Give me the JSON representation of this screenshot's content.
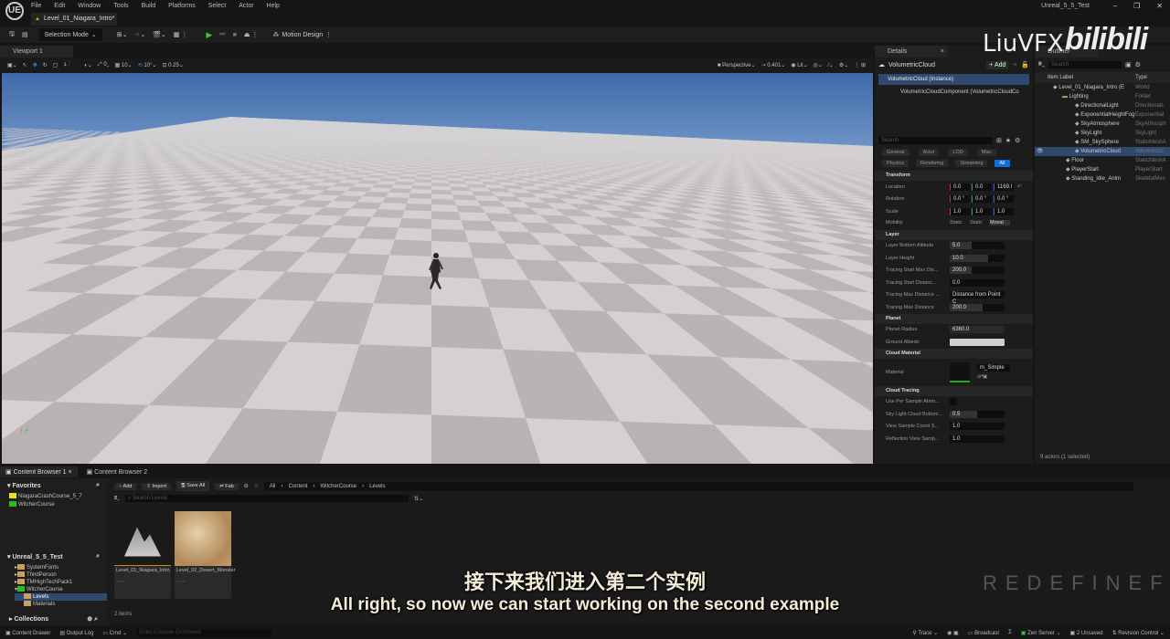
{
  "app": {
    "logo": "UE",
    "project": "Unreal_5_5_Test",
    "menu": [
      "File",
      "Edit",
      "Window",
      "Tools",
      "Build",
      "Platforms",
      "Select",
      "Actor",
      "Help"
    ],
    "doc_tab": "Level_01_Niagara_Intro*"
  },
  "toolbar": {
    "selection_mode": "Selection Mode",
    "motion_design": "Motion Design"
  },
  "viewport": {
    "tab": "Viewport 1",
    "snap_translate": "0",
    "snap_grid": "10",
    "snap_rotate": "10°",
    "snap_scale": "0.25",
    "view_mode": "Perspective",
    "camera_speed": "0.401",
    "lit": "Lit"
  },
  "details": {
    "tab": "Details",
    "actor": "VolumetricCloud",
    "add": "+ Add",
    "instance": "VolumetricCloud (Instance)",
    "component": "VolumetricCloudComponent (VolumetricCloudCo",
    "search_placeholder": "Search",
    "filters1": [
      "General",
      "Actor",
      "LOD",
      "Misc"
    ],
    "filters2": [
      "Physics",
      "Rendering",
      "Streaming",
      "All"
    ],
    "transform": {
      "title": "Transform",
      "location": {
        "label": "Location",
        "x": "0.0",
        "y": "0.0",
        "z": "1169.l"
      },
      "rotation": {
        "label": "Rotation",
        "x": "0.0 °",
        "y": "0.0 °",
        "z": "0.0 °"
      },
      "scale": {
        "label": "Scale",
        "x": "1.0",
        "y": "1.0",
        "z": "1.0"
      },
      "mobility": {
        "label": "Mobility",
        "options": [
          "Static",
          "Static",
          "Moval"
        ]
      }
    },
    "layer": {
      "title": "Layer",
      "rows": [
        {
          "label": "Layer Bottom Altitude",
          "value": "5.0"
        },
        {
          "label": "Layer Height",
          "value": "10.0"
        },
        {
          "label": "Tracing Start Max Dis...",
          "value": "200.0"
        },
        {
          "label": "Tracing Start Distanc...",
          "value": "0.0"
        },
        {
          "label": "Tracing Max Distance ...",
          "value": "Distance from Point C"
        },
        {
          "label": "Tracing Max Distance",
          "value": "200.0"
        }
      ]
    },
    "planet": {
      "title": "Planet",
      "rows": [
        {
          "label": "Planet Radius",
          "value": "6360.0"
        },
        {
          "label": "Ground Albedo",
          "value": ""
        }
      ]
    },
    "cloud_material": {
      "title": "Cloud Material",
      "label": "Material",
      "value": "m_Simple"
    },
    "cloud_tracing": {
      "title": "Cloud Tracing",
      "rows": [
        {
          "label": "Use Per Sample Atmo...",
          "value": ""
        },
        {
          "label": "Sky Light Cloud Bottom...",
          "value": "0.5"
        },
        {
          "label": "View Sample Count S...",
          "value": "1.0"
        },
        {
          "label": "Reflection View Samp...",
          "value": "1.0"
        }
      ]
    }
  },
  "outliner": {
    "tab": "Outliner",
    "search_placeholder": "Search",
    "col_label": "Item Label",
    "col_type": "Type",
    "items": [
      {
        "label": "Level_01_Niagara_Intro (E",
        "type": "World"
      },
      {
        "label": "Lighting",
        "type": "Folder"
      },
      {
        "label": "DirectionalLight",
        "type": "DirectionalL"
      },
      {
        "label": "ExponentialHeightFog",
        "type": "Exponential"
      },
      {
        "label": "SkyAtmosphere",
        "type": "SkyAtmosph"
      },
      {
        "label": "SkyLight",
        "type": "SkyLight"
      },
      {
        "label": "SM_SkySphere",
        "type": "StaticMeshA"
      },
      {
        "label": "VolumetricCloud",
        "type": "VolumetricC"
      },
      {
        "label": "Floor",
        "type": "StaticMeshA"
      },
      {
        "label": "PlayerStart",
        "type": "PlayerStart"
      },
      {
        "label": "Standing_Idle_Anim",
        "type": "SkeletalMes"
      }
    ],
    "status": "9 actors (1 selected)"
  },
  "content_browser": {
    "tabs": [
      "Content Browser 1",
      "Content Browser 2"
    ],
    "favorites": "Favorites",
    "fav_items": [
      "NiagaraCrashCourse_5_7",
      "WitcherCourse"
    ],
    "project": "Unreal_5_5_Test",
    "tree": [
      "SystemFonts",
      "ThirdPerson",
      "TMHighTechPack1",
      "WitcherCourse",
      "Levels",
      "Materials"
    ],
    "collections": "Collections",
    "buttons": {
      "add": "Add",
      "import": "Import",
      "save_all": "Save All",
      "fab": "Fab"
    },
    "path": [
      "All",
      "Content",
      "WitcherCourse",
      "Levels"
    ],
    "search_placeholder": "Search Levels",
    "assets": [
      {
        "name": "Level_01_Niagara_Intro",
        "type": "Level"
      },
      {
        "name": "Level_02_Desert_Monster",
        "type": "Level"
      }
    ],
    "count": "2 items"
  },
  "statusbar": {
    "content_drawer": "Content Drawer",
    "output_log": "Output Log",
    "cmd": "Cmd",
    "console_placeholder": "Enter Console Command",
    "trace": "Trace",
    "broadcast": "Broadcast",
    "zen": "Zen Server",
    "unsaved": "2 Unsaved",
    "revision": "Revision Control"
  },
  "subtitles": {
    "cn": "接下来我们进入第二个实例",
    "en": "All right, so now we can start working on the second example"
  },
  "watermarks": {
    "liuvfx": "LiuVFX",
    "bilibili": "bilibili",
    "redefinefx": "REDEFINEFX"
  }
}
